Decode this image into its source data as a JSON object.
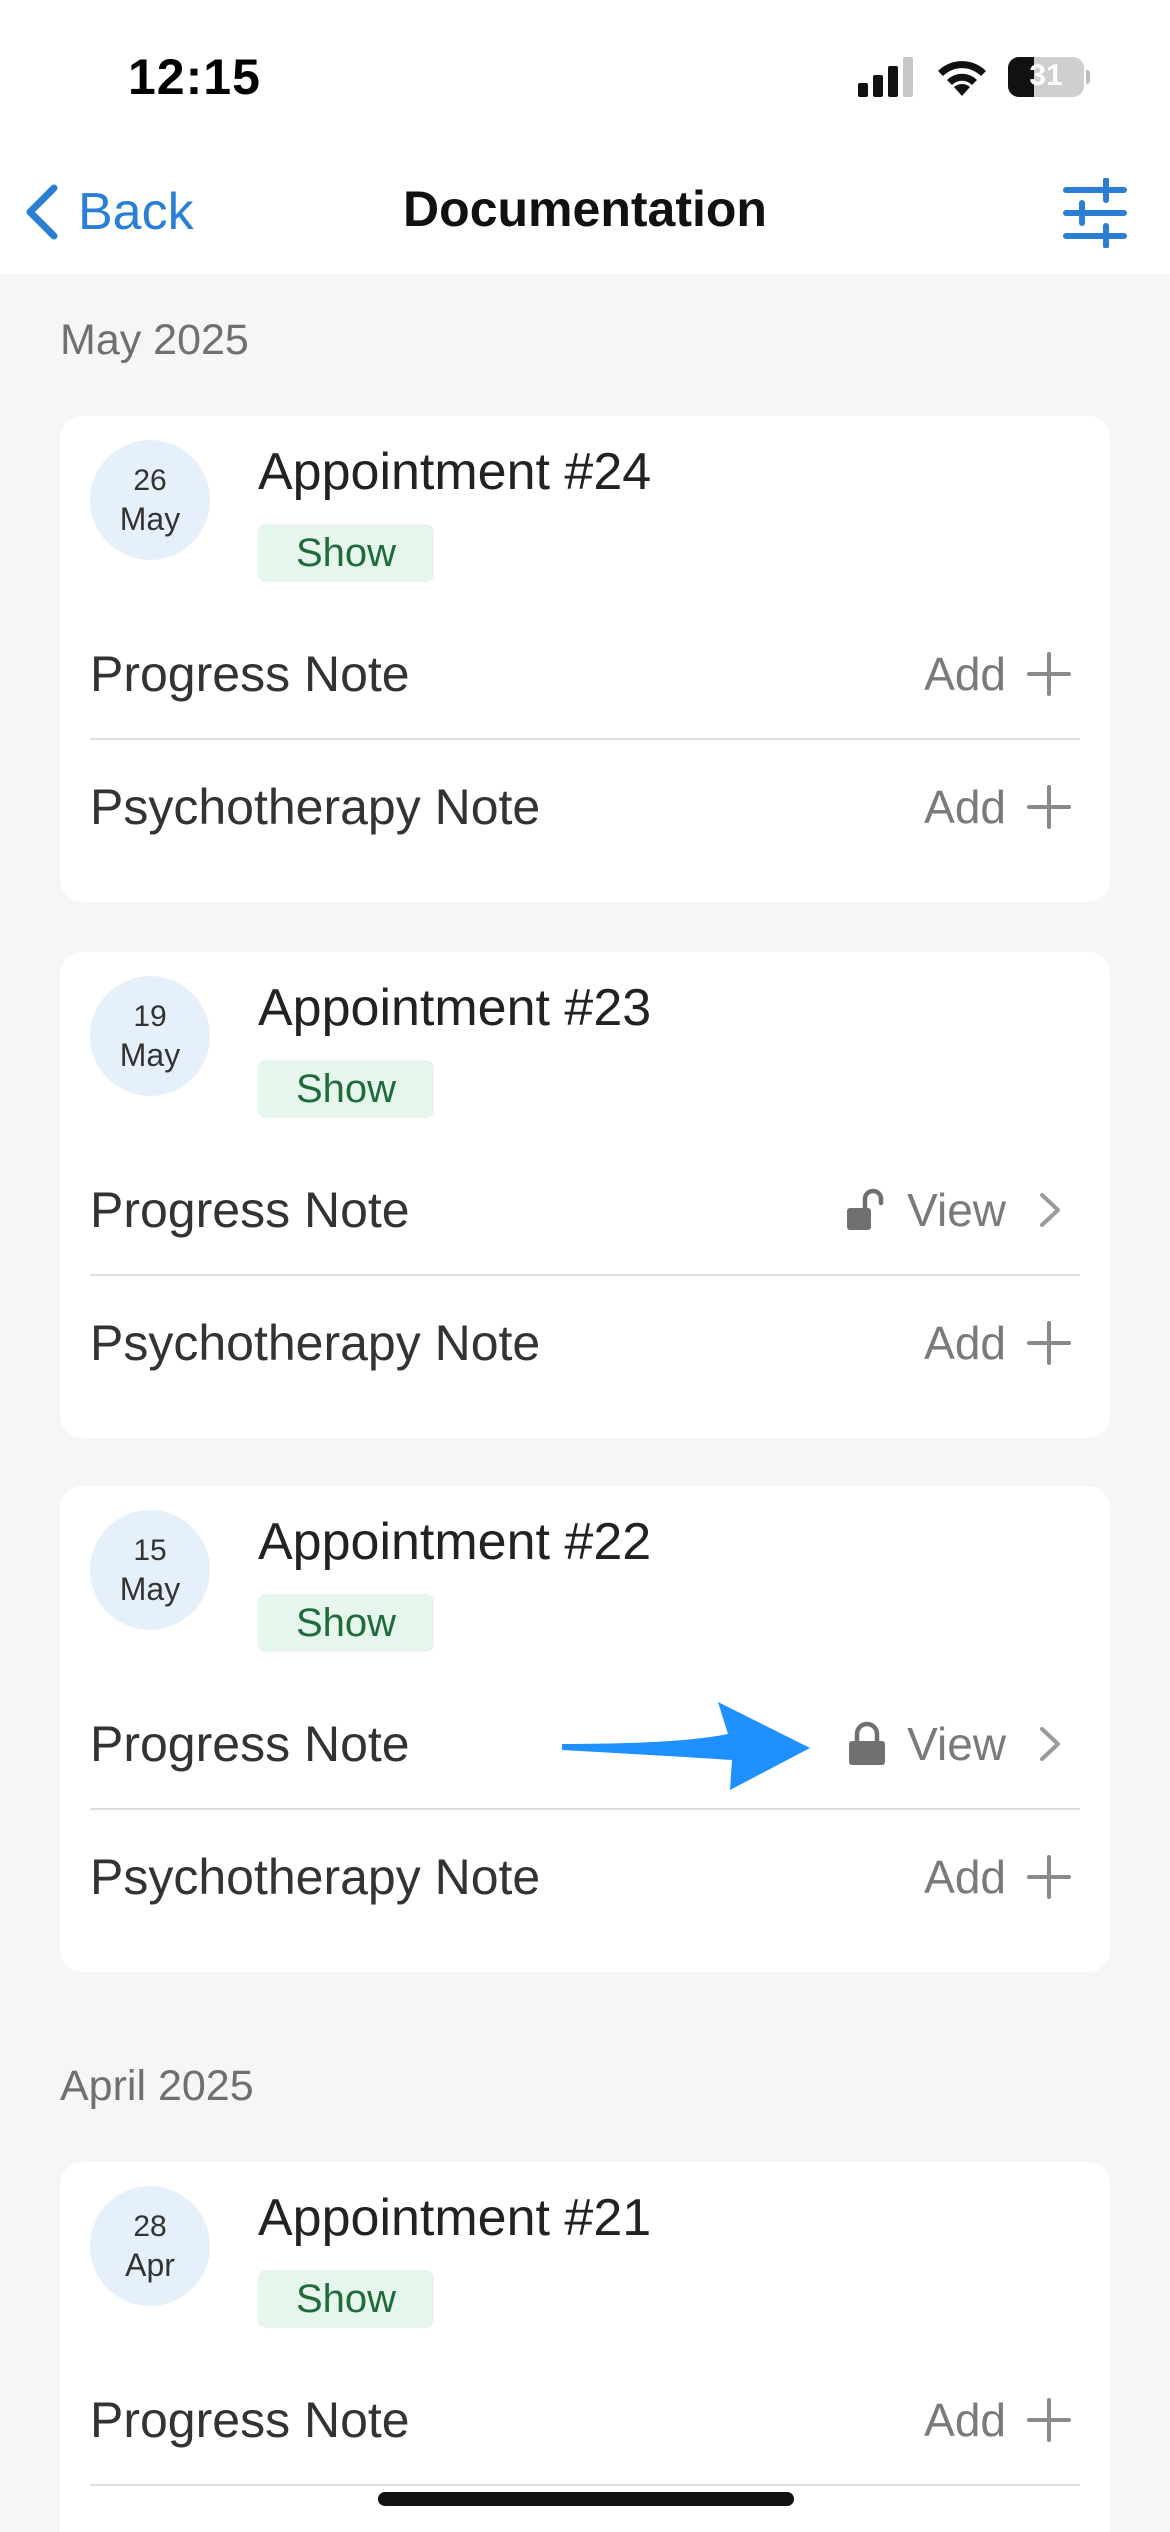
{
  "status_bar": {
    "time": "12:15",
    "battery": "31"
  },
  "nav": {
    "back_label": "Back",
    "title": "Documentation"
  },
  "colors": {
    "accent": "#2a7fd4",
    "badge_bg": "#e6f6ec",
    "badge_text": "#1f6b3c",
    "date_circle": "#e6f0fa",
    "arrow": "#1e90ff"
  },
  "sections": [
    {
      "month": "May 2025",
      "appointments": [
        {
          "day": "26",
          "month": "May",
          "title": "Appointment #24",
          "status": "Show",
          "notes": [
            {
              "label": "Progress Note",
              "action": "Add",
              "icon": "plus-icon"
            },
            {
              "label": "Psychotherapy Note",
              "action": "Add",
              "icon": "plus-icon"
            }
          ]
        },
        {
          "day": "19",
          "month": "May",
          "title": "Appointment #23",
          "status": "Show",
          "notes": [
            {
              "label": "Progress Note",
              "action": "View",
              "icon": "chevron-right-icon",
              "lock": "unlocked-lock-icon"
            },
            {
              "label": "Psychotherapy Note",
              "action": "Add",
              "icon": "plus-icon"
            }
          ]
        },
        {
          "day": "15",
          "month": "May",
          "title": "Appointment #22",
          "status": "Show",
          "notes": [
            {
              "label": "Progress Note",
              "action": "View",
              "icon": "chevron-right-icon",
              "lock": "locked-lock-icon"
            },
            {
              "label": "Psychotherapy Note",
              "action": "Add",
              "icon": "plus-icon"
            }
          ]
        }
      ]
    },
    {
      "month": "April 2025",
      "appointments": [
        {
          "day": "28",
          "month": "Apr",
          "title": "Appointment #21",
          "status": "Show",
          "notes": [
            {
              "label": "Progress Note",
              "action": "Add",
              "icon": "plus-icon"
            }
          ]
        }
      ]
    }
  ]
}
